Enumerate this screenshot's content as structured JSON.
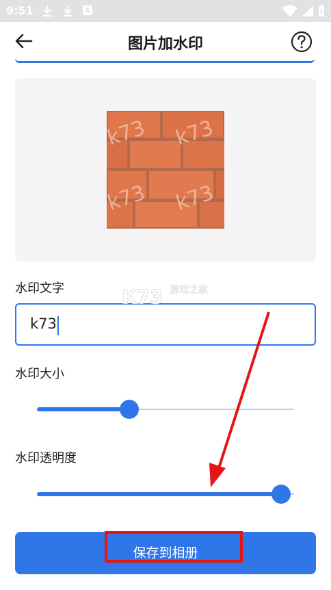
{
  "status_bar": {
    "time": "9:51",
    "icons": [
      "download-icon",
      "download-icon",
      "a-badge-icon",
      "wifi-icon",
      "signal-icon",
      "battery-icon"
    ]
  },
  "app_bar": {
    "title": "图片加水印",
    "back_icon": "back-arrow-icon",
    "help_icon": "help-icon"
  },
  "preview": {
    "watermark_marks": [
      "k73",
      "k73",
      "k73",
      "k73"
    ]
  },
  "form": {
    "text_label": "水印文字",
    "text_value": "k73",
    "size_label": "水印大小",
    "size_fraction": 0.36,
    "opacity_label": "水印透明度",
    "opacity_fraction": 0.95
  },
  "save_button": {
    "label": "保存到相册"
  },
  "site_watermark": {
    "logo": "K73",
    "text": "游戏之家"
  },
  "colors": {
    "accent": "#2f76e8",
    "annotation": "#e51515"
  }
}
